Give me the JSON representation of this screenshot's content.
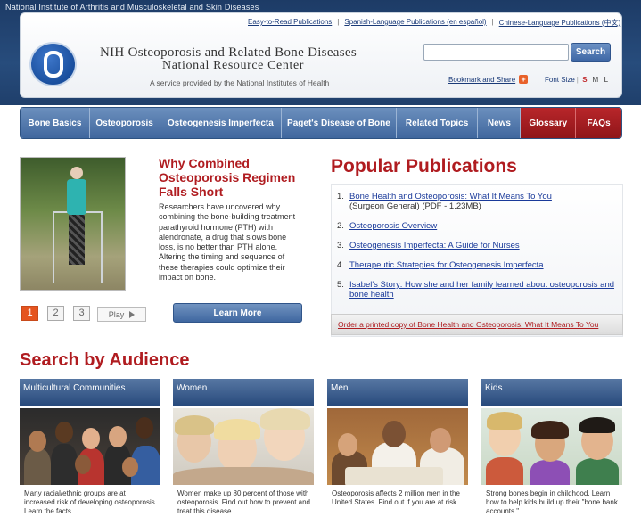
{
  "header": {
    "agency": "National Institute of Arthritis and Musculoskeletal and Skin Diseases",
    "toplinks": [
      "Easy-to-Read Publications",
      "Spanish-Language Publications (en español)",
      "Chinese-Language Publications (中文)"
    ],
    "title_line1": "NIH Osteoporosis and Related Bone Diseases",
    "title_line2": "National Resource Center",
    "tagline": "A service provided by the National Institutes of Health",
    "search_placeholder": "",
    "search_label": "Search",
    "bookmark_label": "Bookmark and Share",
    "fontsize_label": "Font Size",
    "fontsize_options": [
      "S",
      "M",
      "L"
    ],
    "logo_icon": "nih-logo-icon"
  },
  "nav": {
    "items": [
      {
        "label": "Bone Basics",
        "width": 78
      },
      {
        "label": "Osteoporosis",
        "width": 79
      },
      {
        "label": "Osteogenesis Imperfecta",
        "width": 137
      },
      {
        "label": "Paget's Disease of Bone",
        "width": 129
      },
      {
        "label": "Related Topics",
        "width": 92
      },
      {
        "label": "News",
        "width": 48
      },
      {
        "label": "Glossary",
        "width": 62
      },
      {
        "label": "FAQs",
        "width": 51
      }
    ]
  },
  "feature": {
    "title": "Why Combined Osteoporosis Regimen Falls Short",
    "body": "Researchers have uncovered why combining the bone-building treatment parathyroid hormone (PTH) with alendronate, a drug that slows bone loss, is no better than PTH alone. Altering the timing and sequence of these therapies could optimize their impact on bone.",
    "pages": [
      "1",
      "2",
      "3"
    ],
    "play_label": "Play",
    "learn_more_label": "Learn More"
  },
  "popular": {
    "title": "Popular Publications",
    "items": [
      {
        "num": "1.",
        "link": "Bone Health and Osteoporosis: What It Means To You",
        "note": "(Surgeon General) (PDF - 1.23MB)"
      },
      {
        "num": "2.",
        "link": "Osteoporosis Overview",
        "note": ""
      },
      {
        "num": "3.",
        "link": "Osteogenesis Imperfecta: A Guide for Nurses",
        "note": ""
      },
      {
        "num": "4.",
        "link": "Therapeutic Strategies for Osteogenesis Imperfecta",
        "note": ""
      },
      {
        "num": "5.",
        "link": "Isabel's Story: How she and her family learned about osteoporosis and bone health",
        "note": ""
      }
    ],
    "order_link": "Order a printed copy of Bone Health and Osteoporosis: What It Means To You"
  },
  "audience": {
    "title": "Search by Audience",
    "cards": [
      {
        "heading": "Multicultural Communities",
        "desc": "Many racial/ethnic groups are at increased risk of developing osteoporosis. Learn the facts."
      },
      {
        "heading": "Women",
        "desc": "Women make up 80 percent of those with osteoporosis. Find out how to prevent and treat this disease."
      },
      {
        "heading": "Men",
        "desc": "Osteoporosis affects 2 million men in the United States. Find out if you are at risk."
      },
      {
        "heading": "Kids",
        "desc": "Strong bones begin in childhood. Learn how to help kids build up their \"bone bank accounts.\""
      }
    ]
  },
  "colors": {
    "brand_red": "#b01c20",
    "nav_blue": "#40679e",
    "header_blue": "#1d3b66",
    "active_page": "#e5541f"
  }
}
